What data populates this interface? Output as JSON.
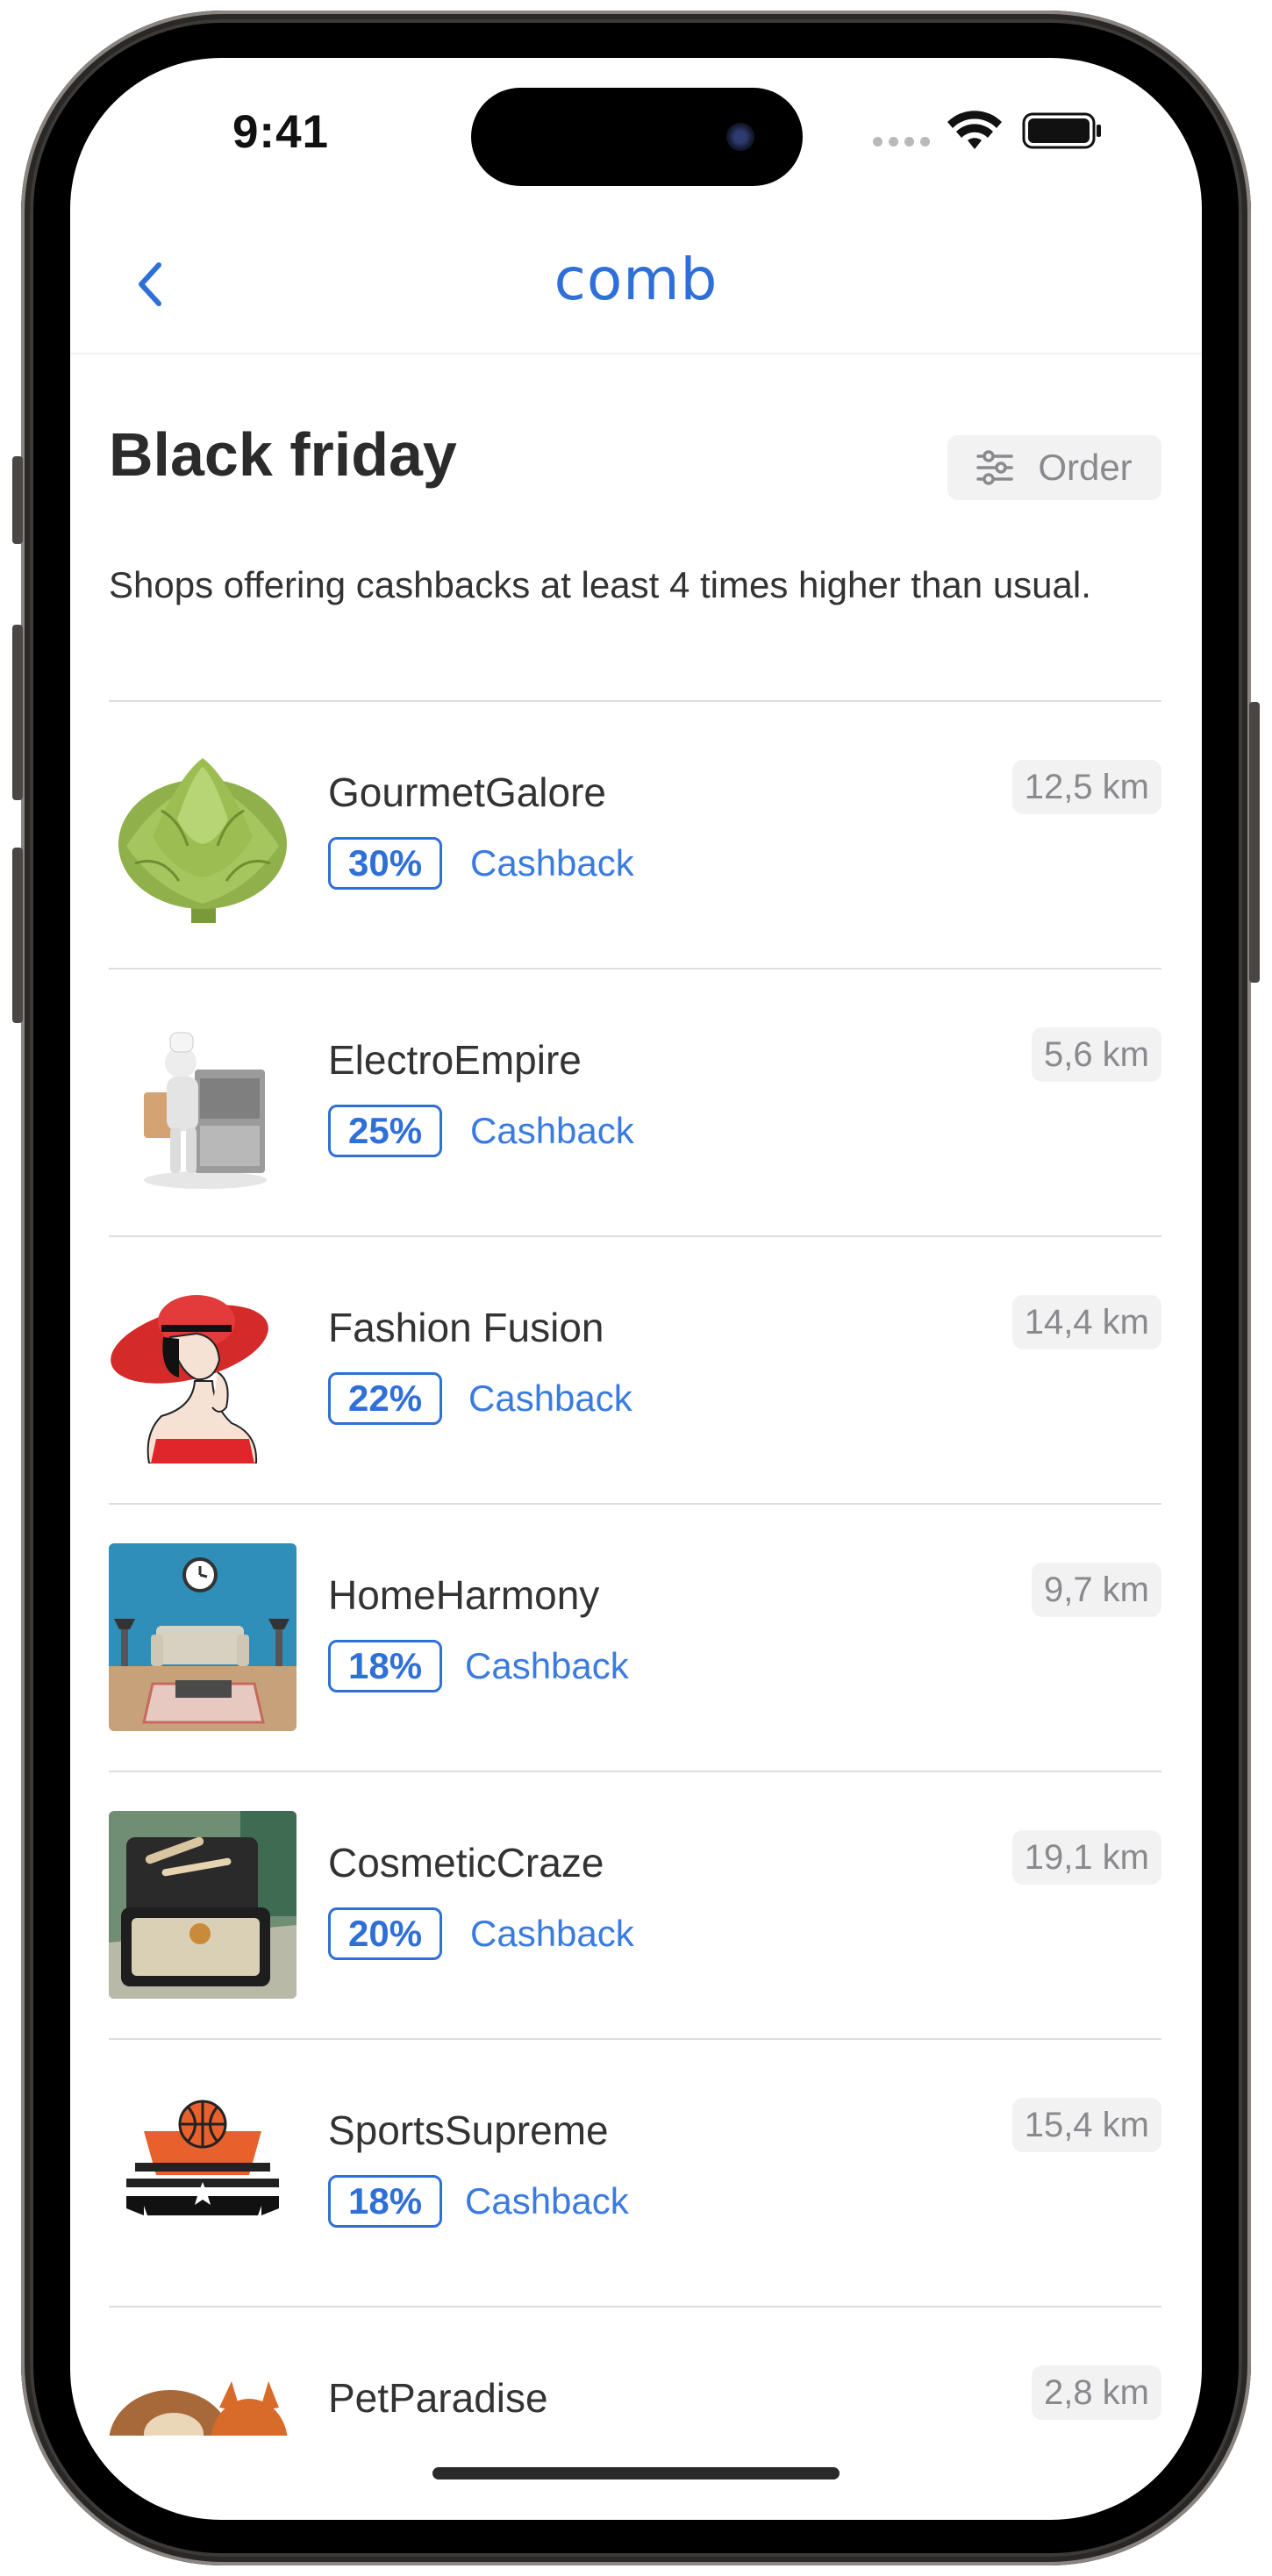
{
  "status_bar": {
    "time": "9:41"
  },
  "nav": {
    "brand": "comb"
  },
  "header": {
    "title": "Black friday",
    "order_label": "Order",
    "subtitle": "Shops offering cashbacks at least 4 times higher than usual."
  },
  "colors": {
    "accent": "#2f6fd8",
    "link": "#3a7be0",
    "chip_bg": "#f2f2f3"
  },
  "shops": [
    {
      "name": "GourmetGalore",
      "cashback_pct": "30%",
      "cashback_label": "Cashback",
      "distance": "12,5 km",
      "image": "artichoke"
    },
    {
      "name": "ElectroEmpire",
      "cashback_pct": "25%",
      "cashback_label": "Cashback",
      "distance": "5,6 km",
      "image": "chef-appliance"
    },
    {
      "name": "Fashion Fusion",
      "cashback_pct": "22%",
      "cashback_label": "Cashback",
      "distance": "14,4 km",
      "image": "woman-red-hat"
    },
    {
      "name": "HomeHarmony",
      "cashback_pct": "18%",
      "cashback_label": "Cashback",
      "distance": "9,7 km",
      "image": "living-room"
    },
    {
      "name": "CosmeticCraze",
      "cashback_pct": "20%",
      "cashback_label": "Cashback",
      "distance": "19,1 km",
      "image": "cosmetics-case"
    },
    {
      "name": "SportsSupreme",
      "cashback_pct": "18%",
      "cashback_label": "Cashback",
      "distance": "15,4 km",
      "image": "basketball-logo"
    },
    {
      "name": "PetParadise",
      "cashback_pct": "",
      "cashback_label": "",
      "distance": "2,8 km",
      "image": "pets"
    }
  ]
}
